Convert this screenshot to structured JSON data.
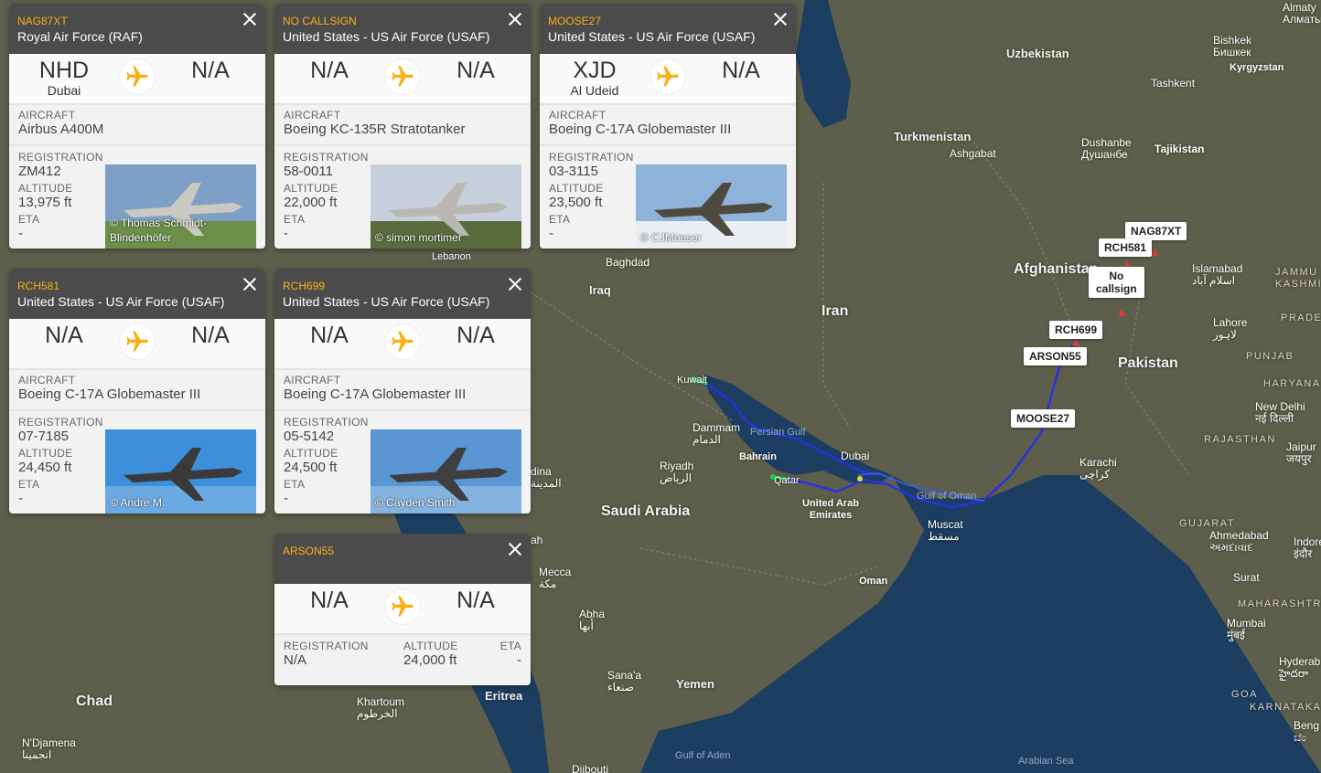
{
  "map": {
    "countries": {
      "uzbekistan": "Uzbekistan",
      "turkmenistan": "Turkmenistan",
      "afghanistan": "Afghanistan",
      "iran": "Iran",
      "iraq": "Iraq",
      "pakistan": "Pakistan",
      "saudi_arabia": "Saudi Arabia",
      "yemen": "Yemen",
      "oman": "Oman",
      "uae": "United Arab\nEmirates",
      "eritrea": "Eritrea",
      "chad": "Chad",
      "qatar": "Qatar",
      "bahrain": "Bahrain",
      "kuwait": "Kuwait",
      "tajikistan": "Tajikistan",
      "kyrgyzstan": "Kyrgyzstan"
    },
    "cities": {
      "almaty": "Almaty\nАлматы",
      "bishkek": "Bishkek\nБишкек",
      "tashkent": "Tashkent",
      "ashgabat": "Ashgabat",
      "dushanbe": "Dushanbe\nДушанбе",
      "islamabad": "Islamabad\nاسلام آباد",
      "lahore": "Lahore\nلاہور",
      "baghdad": "Baghdad",
      "dammam": "Dammam\nالدمام",
      "riyadh": "Riyadh\nالرياض",
      "dubai": "Dubai",
      "muscat": "Muscat\nمسقط",
      "karachi": "Karachi\nکراچی",
      "new_delhi": "New Delhi\nनई दिल्ली",
      "jaipur": "Jaipur\nजयपुर",
      "ahmedabad": "Ahmedabad\nઅમદાવાદ",
      "indore": "Indore\nइंदौर",
      "surat": "Surat",
      "mumbai": "Mumbai\nमुंबई",
      "hyderabad": "Hyderab\nహైదరా",
      "bengaluru": "Beng\nಬೆಂ",
      "mecca": "Mecca\nمكة",
      "medina": "dina\nالمدينة",
      "abha": "Abha\nأبها",
      "sanaa": "Sana'a\nصنعاء",
      "khartoum": "Khartoum\nالخرطوم",
      "ndjamena": "N'Djamena\nانجمينا",
      "djibouti": "Djibouti",
      "jammu": "JAMMU AND\nKASHMIR",
      "punjab": "PUNJAB",
      "haryana": "HARYANA",
      "rajasthan": "RAJASTHAN",
      "gujarat": "GUJARAT",
      "maharashtra": "MAHARASHTRA",
      "karnataka": "KARNATAKA",
      "goa": "GOA",
      "pradesh": "PRADE",
      "lebanon": "Lebanon",
      "ah": "ah"
    },
    "seas": {
      "persian_gulf": "Persian Gulf",
      "gulf_of_oman": "Gulf of Oman",
      "gulf_of_aden": "Gulf of Aden",
      "arabian_sea": "Arabian Sea"
    },
    "aircraft_tags": {
      "nag87xt": "NAG87XT",
      "rch581": "RCH581",
      "no_callsign": "No\ncallsign",
      "rch699": "RCH699",
      "arson55": "ARSON55",
      "moose27": "MOOSE27"
    },
    "colors": {
      "land": "#5d5e4b",
      "sea": "#1c3e60",
      "track_main": "#2633e0",
      "track_start": "#1ed35a"
    }
  },
  "panels": [
    {
      "callsign": "NAG87XT",
      "operator": "Royal Air Force (RAF)",
      "from_code": "NHD",
      "from_city": "Dubai",
      "to_code": "N/A",
      "aircraft_label": "AIRCRAFT",
      "aircraft": "Airbus A400M",
      "registration_label": "REGISTRATION",
      "registration": "ZM412",
      "altitude_label": "ALTITUDE",
      "altitude": "13,975 ft",
      "eta_label": "ETA",
      "eta": "-",
      "photo_credit": "© Thomas Schmidt-Blindenhöfer"
    },
    {
      "callsign": "NO CALLSIGN",
      "operator": "United States - US Air Force (USAF)",
      "from_code": "N/A",
      "from_city": "",
      "to_code": "N/A",
      "aircraft_label": "AIRCRAFT",
      "aircraft": "Boeing KC-135R Stratotanker",
      "registration_label": "REGISTRATION",
      "registration": "58-0011",
      "altitude_label": "ALTITUDE",
      "altitude": "22,000 ft",
      "eta_label": "ETA",
      "eta": "-",
      "photo_credit": "© simon mortimer"
    },
    {
      "callsign": "MOOSE27",
      "operator": "United States - US Air Force (USAF)",
      "from_code": "XJD",
      "from_city": "Al Udeid",
      "to_code": "N/A",
      "aircraft_label": "AIRCRAFT",
      "aircraft": "Boeing C-17A Globemaster III",
      "registration_label": "REGISTRATION",
      "registration": "03-3115",
      "altitude_label": "ALTITUDE",
      "altitude": "23,500 ft",
      "eta_label": "ETA",
      "eta": "-",
      "photo_credit": "© CJMoeser"
    },
    {
      "callsign": "RCH581",
      "operator": "United States - US Air Force (USAF)",
      "from_code": "N/A",
      "from_city": "",
      "to_code": "N/A",
      "aircraft_label": "AIRCRAFT",
      "aircraft": "Boeing C-17A Globemaster III",
      "registration_label": "REGISTRATION",
      "registration": "07-7185",
      "altitude_label": "ALTITUDE",
      "altitude": "24,450 ft",
      "eta_label": "ETA",
      "eta": "-",
      "photo_credit": "© Andre M."
    },
    {
      "callsign": "RCH699",
      "operator": "United States - US Air Force (USAF)",
      "from_code": "N/A",
      "from_city": "",
      "to_code": "N/A",
      "aircraft_label": "AIRCRAFT",
      "aircraft": "Boeing C-17A Globemaster III",
      "registration_label": "REGISTRATION",
      "registration": "05-5142",
      "altitude_label": "ALTITUDE",
      "altitude": "24,500 ft",
      "eta_label": "ETA",
      "eta": "-",
      "photo_credit": "© Cayden Smith"
    },
    {
      "callsign": "ARSON55",
      "operator": "",
      "from_code": "N/A",
      "from_city": "",
      "to_code": "N/A",
      "registration_label": "REGISTRATION",
      "registration": "N/A",
      "altitude_label": "ALTITUDE",
      "altitude": "24,000 ft",
      "eta_label": "ETA",
      "eta": "-"
    }
  ]
}
